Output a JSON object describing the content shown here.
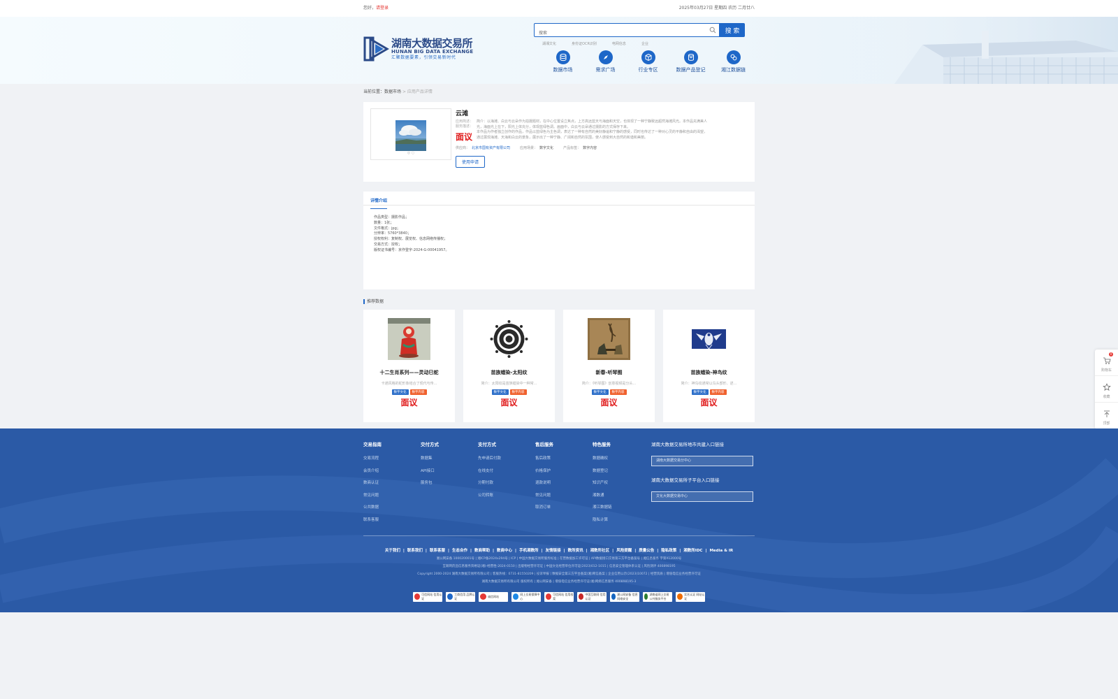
{
  "topbar": {
    "greeting": "您好，",
    "login": "请登录",
    "date": "2025年03月27日 星期四 农历 二月廿八"
  },
  "logo": {
    "cn": "湖南大数据交易所",
    "en": "HUNAN BIG DATA EXCHANGE",
    "slogan": "汇聚数据要素，引领交易新时代"
  },
  "search": {
    "placeholder": "搜索",
    "button": "搜 索",
    "hotwords": [
      "湖湘文化",
      "身份证OCR识别",
      "电网信息",
      "企业"
    ]
  },
  "nav": [
    {
      "label": "数据市场",
      "icon": "database-icon"
    },
    {
      "label": "需求广场",
      "icon": "compass-icon"
    },
    {
      "label": "行业专区",
      "icon": "cube-icon"
    },
    {
      "label": "数据产品登记",
      "icon": "register-icon"
    },
    {
      "label": "湘江数据链",
      "icon": "chain-icon"
    }
  ],
  "breadcrumb": {
    "label": "当前位置：",
    "link": "数据市场",
    "sep": " > ",
    "current": "应用产品详情"
  },
  "product": {
    "title": "云滩",
    "desc_label": "应用简述：",
    "desc_label2": "服务描述：",
    "desc1": "简介：以海滩、白云与云朵作为拍摄题材，在中心位置设立焦点，上方高远蓝天与海面和天空，也体现了一种宁静致远超然海滩风光。本作品充满美人",
    "desc2": "光，海面光上在下，阳光上体充分，体现蓝绿色调。画面中，白云与云朵通过摄影的方式保存下来。",
    "desc3": "本作品为作者独立创作的作品，作品以蓝绿色为主色调，表达了一种有自然的美好静谧和宁静的感受，同时也传达了一种对心灵的平静和自由的渴望，",
    "desc4": "通过展现海滩、天海和白云的景象，展示出了一种宁静、广阔和自然的氛围，使人感受到大自然的和谐和美丽。",
    "price": "面议",
    "supplier_label": "供应商：",
    "supplier": "北京市国有资产有限公司",
    "scene_label": "应用场景：",
    "scene": "数字文化",
    "tag_label": "产品标签：",
    "tag": "数字内容",
    "apply": "使用申请"
  },
  "detail": {
    "tab": "详情介绍",
    "lines": [
      "作品类型：摄影作品；",
      "数量：1张；",
      "文件格式：jpg；",
      "分辨率：5760*3840；",
      "授权权利：复制权、展览权、信息网络传播权；",
      "交易方式：授权；",
      "版权证书编号：京作登字-2024-G-00041957。"
    ]
  },
  "recommend": {
    "heading": "推荐数据",
    "items": [
      {
        "title": "十二生肖系列——灵动巳蛇",
        "desc": "卡通风格的蛇形象结合了现代与传...",
        "tags": [
          "数字文化",
          "数字内容"
        ],
        "price": "面议"
      },
      {
        "title": "苗族蜡染-太阳纹",
        "desc": "简介：太阳纹是苗族蜡染中一种常...",
        "tags": [
          "数字文化",
          "数字内容"
        ],
        "price": "面议"
      },
      {
        "title": "新春-听琴图",
        "desc": "简介：《听琴图》创意视频是分头...",
        "tags": [
          "数字文化",
          "数字内容"
        ],
        "price": "面议"
      },
      {
        "title": "苗族蜡染-神鸟纹",
        "desc": "简介：神鸟纹通常以鸟头部形、述...",
        "tags": [
          "数字文化",
          "数字内容"
        ],
        "price": "面议"
      }
    ]
  },
  "sidefloat": {
    "cart": "购物车",
    "cart_count": "0",
    "fav": "收藏",
    "top": "顶部"
  },
  "footer": {
    "cols": [
      {
        "h": "交易指南",
        "items": [
          "交易流程",
          "会员介绍",
          "数商认证",
          "常见问题",
          "公共数据",
          "联系客服"
        ]
      },
      {
        "h": "交付方式",
        "items": [
          "数据集",
          "API接口",
          "服务包"
        ]
      },
      {
        "h": "支付方式",
        "items": [
          "先申请后付款",
          "在线支付",
          "分期付款",
          "公司转账"
        ]
      },
      {
        "h": "售后服务",
        "items": [
          "售后政策",
          "价格保护",
          "退款说明",
          "常见问题",
          "取消订单"
        ]
      },
      {
        "h": "特色服务",
        "items": [
          "数据确权",
          "数据登记",
          "知识产权",
          "湘数通",
          "湘江数据链",
          "隐私计算"
        ]
      }
    ],
    "right_h1": "湖南大数据交易所地市共建入口链接",
    "right_sel1": "湖南大数据交易分中心",
    "right_h2": "湖南大数据交易所子平台入口链接",
    "right_sel2": "文化大数据交易中心",
    "links": [
      "关于我们",
      "联系我们",
      "联系客服",
      "生态合作",
      "数商帮助",
      "数商中心",
      "手机湘数所",
      "友情链接",
      "数所资讯",
      "湘数所社区",
      "风险提醒",
      "质量公告",
      "隐私政策",
      "湘数所IDC",
      "Media & IR"
    ],
    "lines": [
      "湘公网安备 100020001号  |  湘ICP备2024x294号  |  ICP  |  中国大数据交易所服务标准  |  在营数据加工许可证  |  API数据接口交易第三方平台备案号  |  湘信息服务 字第X12000号",
      "互联网药品信息服务资格证(湘)-经营性-2024-0150  |  出版物经营许可证  |  中国文化经营单位许可证(2023)012-1015  |  信息安全管理体系认证  |  风险测评  400898195",
      "Copyright 2000-2024 湖南大数据交易所有限公司  |  客服热线：0731-81550209  |  投诉举报  |  数据安全第三方平台备案(湘)网信备案  |  企业信用公示(2023)10072  |  经营资质  |  增值电信业务经营许可证",
      "湖南大数据交易所有限公司 版权所有  |  湘公网安备  |  增值电信业务经营许可证(湘)网络信息服务 400898195-3"
    ],
    "badges": [
      "可信网站 信用认证",
      "工商信用 品牌认证",
      "诚信网站",
      "网上交易保障中心",
      "可信网站 信用档案",
      "中国互联网 信用认证",
      "湘公网安备 信息网络安全",
      "湖南省网上交易 公共服务平台",
      "实名认证 网站认证"
    ]
  },
  "colors": {
    "brand": "#1e67c8",
    "price": "#e01a1a",
    "footer": "#2b5aa6",
    "tag_blue": "#2d6fc9",
    "tag_orange": "#f0612e"
  }
}
